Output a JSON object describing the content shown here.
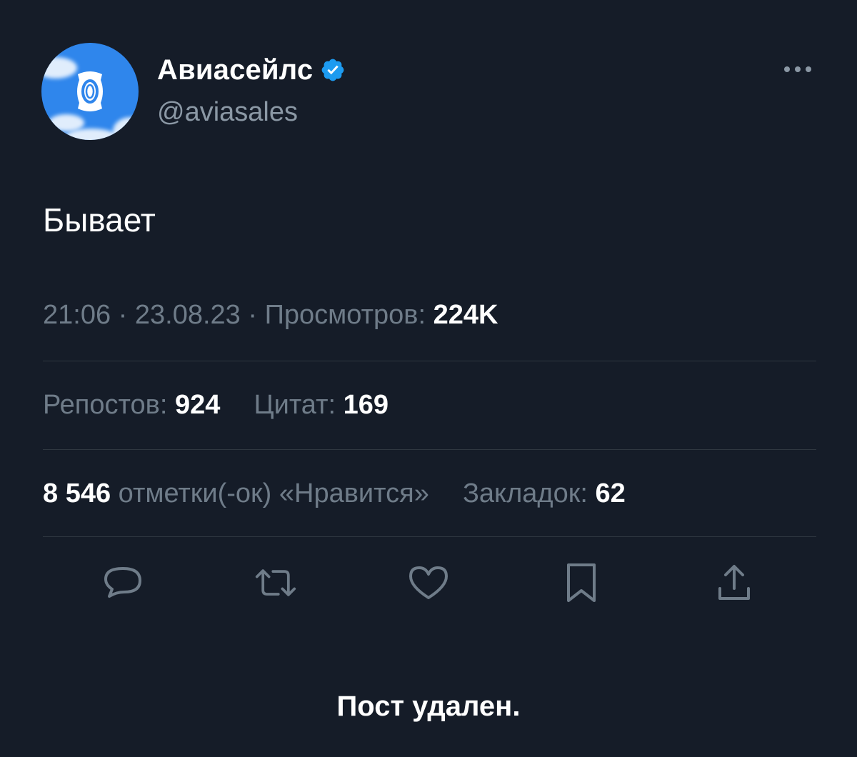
{
  "author": {
    "name": "Авиасейлс",
    "handle": "@aviasales",
    "verified": true,
    "avatar_icon": "aviasales-logo-icon",
    "avatar_color": "#2f86ec"
  },
  "tweet": {
    "text": "Бывает",
    "time": "21:06",
    "date": "23.08.23",
    "views_label": "Просмотров:",
    "views": "224K"
  },
  "stats": {
    "reposts_label": "Репостов:",
    "reposts": "924",
    "quotes_label": "Цитат:",
    "quotes": "169",
    "likes": "8 546",
    "likes_label": "отметки(-ок) «Нравится»",
    "bookmarks_label": "Закладок:",
    "bookmarks": "62"
  },
  "actions": [
    {
      "name": "reply",
      "icon": "comment-icon"
    },
    {
      "name": "repost",
      "icon": "repost-icon"
    },
    {
      "name": "like",
      "icon": "heart-icon"
    },
    {
      "name": "bookmark",
      "icon": "bookmark-icon"
    },
    {
      "name": "share",
      "icon": "share-icon"
    }
  ],
  "status_message": "Пост удален.",
  "colors": {
    "background": "#151c28",
    "text_primary": "#ffffff",
    "text_secondary": "#6f7c89",
    "verified_badge": "#1d9bf0",
    "divider": "#2f3740"
  }
}
